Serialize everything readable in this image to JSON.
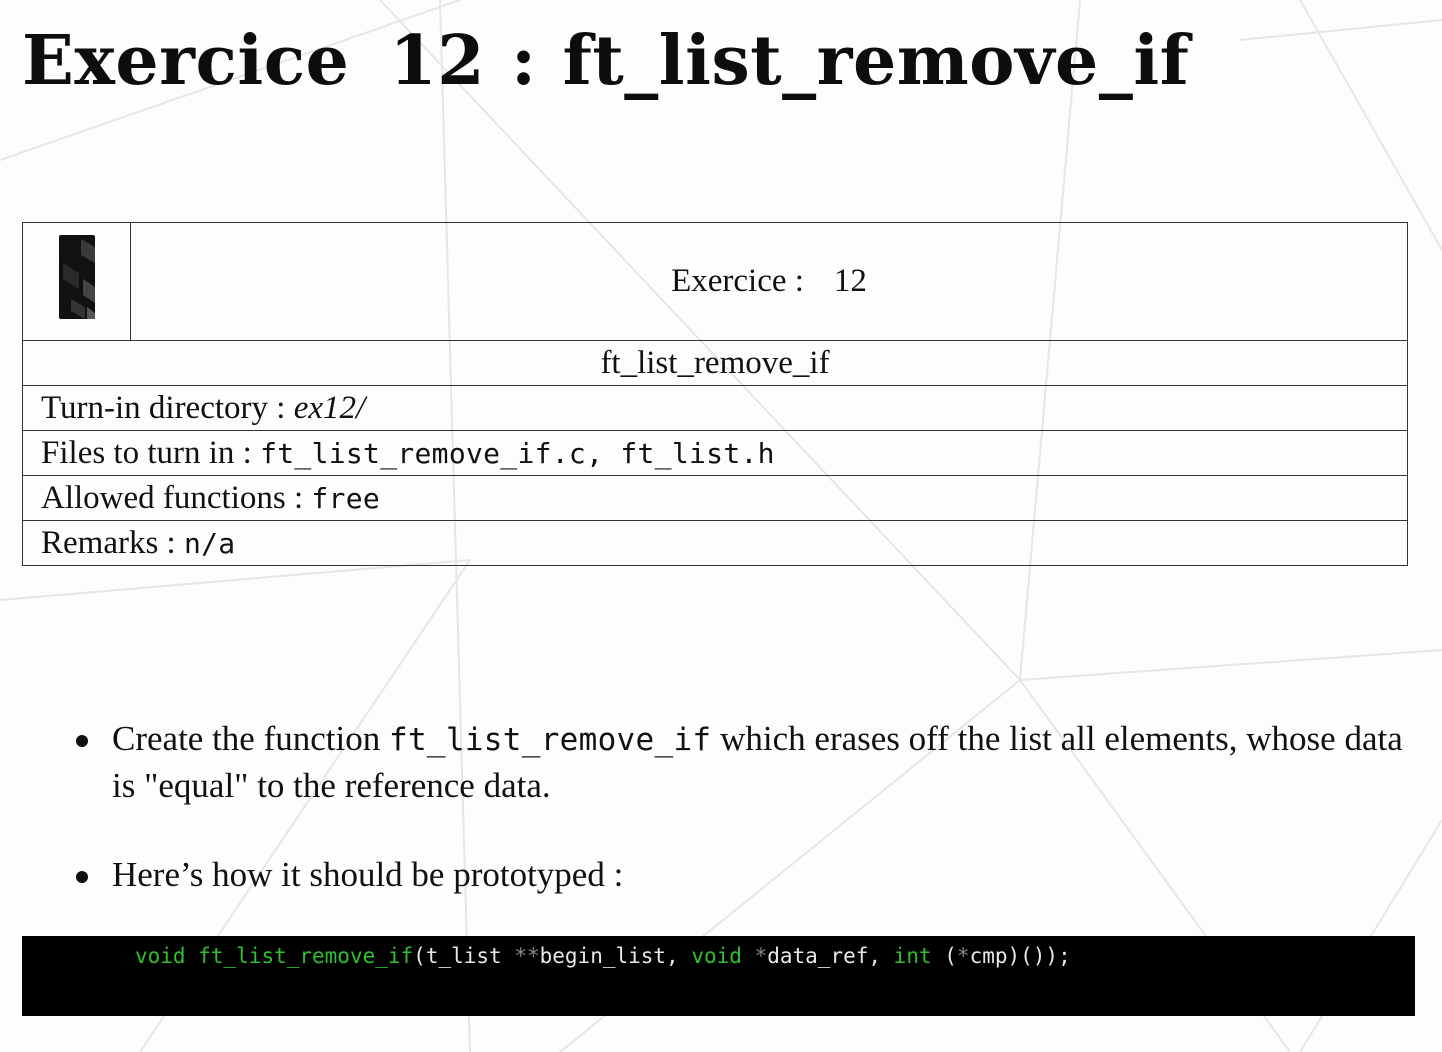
{
  "header": {
    "title_word": "Exercice",
    "title_number": "12",
    "title_colon": ":",
    "title_name": "ft_list_remove_if"
  },
  "info_table": {
    "exercise_label": "Exercice :",
    "exercise_number": "12",
    "function_name": "ft_list_remove_if",
    "turn_in_label": "Turn-in directory :",
    "turn_in_value": "ex12/",
    "files_label": "Files to turn in :",
    "files_value": "ft_list_remove_if.c, ft_list.h",
    "allowed_label": "Allowed functions :",
    "allowed_value": "free",
    "remarks_label": "Remarks :",
    "remarks_value": "n/a"
  },
  "bullets": {
    "b1_prefix": "Create the function ",
    "b1_code": "ft_list_remove_if",
    "b1_suffix": " which erases off the list all elements, whose data is \"equal\" to the reference data.",
    "b2_text": "Here’s how it should be prototyped :"
  },
  "code": {
    "kw_void": "void",
    "fn_name": "ft_list_remove_if",
    "open": "(t_list ",
    "stars2": "**",
    "param1": "begin_list, ",
    "kw_void2": "void",
    "space": " ",
    "star1": "*",
    "param2": "data_ref, ",
    "kw_int": "int",
    "open2": " (",
    "star3": "*",
    "param3": "cmp)());"
  },
  "colors": {
    "code_background": "#000000",
    "code_keyword": "#2fbf2f",
    "code_text": "#e8e8e8",
    "border": "#333333"
  },
  "icons": {
    "logo": "42-logo-icon"
  }
}
